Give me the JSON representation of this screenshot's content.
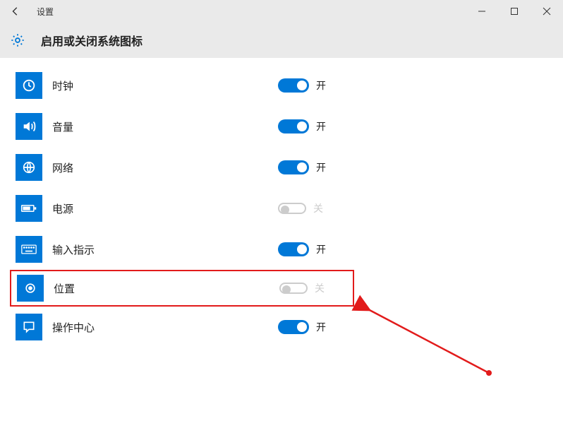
{
  "window": {
    "title": "设置",
    "page_header": "启用或关闭系统图标"
  },
  "states": {
    "on": "开",
    "off": "关"
  },
  "items": [
    {
      "icon": "clock-icon",
      "label": "时钟",
      "state": "on",
      "highlight": false
    },
    {
      "icon": "volume-icon",
      "label": "音量",
      "state": "on",
      "highlight": false
    },
    {
      "icon": "network-icon",
      "label": "网络",
      "state": "on",
      "highlight": false
    },
    {
      "icon": "power-icon",
      "label": "电源",
      "state": "disabled",
      "highlight": false
    },
    {
      "icon": "ime-icon",
      "label": "输入指示",
      "state": "on",
      "highlight": false
    },
    {
      "icon": "location-icon",
      "label": "位置",
      "state": "disabled",
      "highlight": true
    },
    {
      "icon": "action-icon",
      "label": "操作中心",
      "state": "on",
      "highlight": false
    }
  ]
}
